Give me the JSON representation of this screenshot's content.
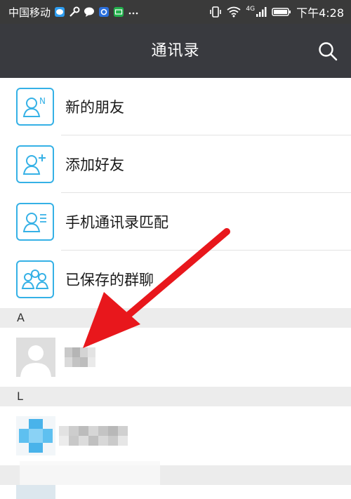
{
  "status_bar": {
    "carrier": "中国移动",
    "time": "下午4:28",
    "network": "4G",
    "app_icons": [
      "chat-bubble-icon",
      "key-icon",
      "message-icon",
      "shield-icon",
      "iqiyi-icon",
      "more-dots-icon"
    ]
  },
  "header": {
    "title": "通讯录",
    "search_icon": "search-icon",
    "background": "#393a3f"
  },
  "function_items": [
    {
      "label": "新的朋友",
      "icon": "new-friend-icon"
    },
    {
      "label": "添加好友",
      "icon": "add-friend-icon"
    },
    {
      "label": "手机通讯录匹配",
      "icon": "phone-contacts-icon"
    },
    {
      "label": "已保存的群聊",
      "icon": "group-chat-icon"
    }
  ],
  "sections": [
    {
      "letter": "A"
    },
    {
      "letter": "L"
    }
  ],
  "colors": {
    "accent": "#35b1e6",
    "arrow": "#e8171c",
    "section_bg": "#ececec"
  }
}
